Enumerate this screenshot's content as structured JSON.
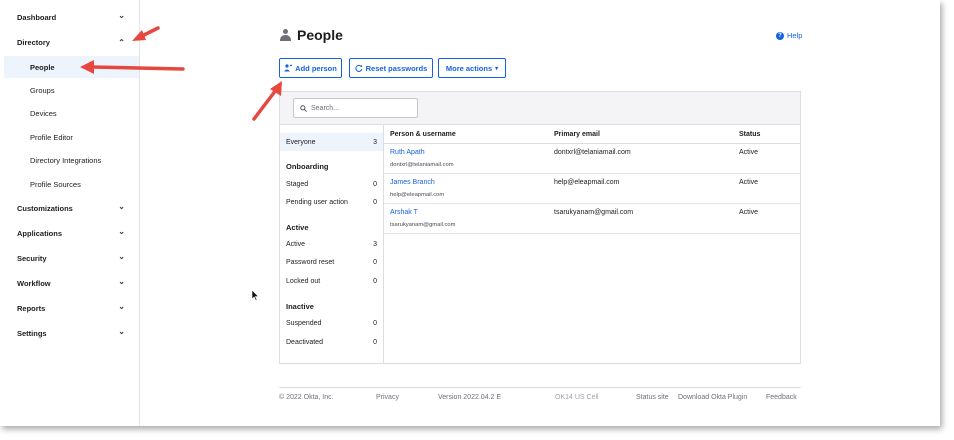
{
  "sidebar": {
    "items": [
      {
        "label": "Dashboard",
        "chevron": "⌄"
      },
      {
        "label": "Directory",
        "chevron": "⌃"
      },
      {
        "label": "People"
      },
      {
        "label": "Groups"
      },
      {
        "label": "Devices"
      },
      {
        "label": "Profile Editor"
      },
      {
        "label": "Directory Integrations"
      },
      {
        "label": "Profile Sources"
      },
      {
        "label": "Customizations",
        "chevron": "⌄"
      },
      {
        "label": "Applications",
        "chevron": "⌄"
      },
      {
        "label": "Security",
        "chevron": "⌄"
      },
      {
        "label": "Workflow",
        "chevron": "⌄"
      },
      {
        "label": "Reports",
        "chevron": "⌄"
      },
      {
        "label": "Settings",
        "chevron": "⌄"
      }
    ]
  },
  "header": {
    "title": "People",
    "help_label": "Help",
    "help_icon": "question-circle-icon"
  },
  "actions": {
    "add_person": "Add person",
    "reset_passwords": "Reset passwords",
    "more_actions": "More actions",
    "more_actions_caret": "▾"
  },
  "search": {
    "placeholder": "Search..."
  },
  "filters": {
    "everyone": {
      "label": "Everyone",
      "count": "3"
    },
    "onboarding_head": "Onboarding",
    "staged": {
      "label": "Staged",
      "count": "0"
    },
    "pending": {
      "label": "Pending user action",
      "count": "0"
    },
    "active_head": "Active",
    "active": {
      "label": "Active",
      "count": "3"
    },
    "password_reset": {
      "label": "Password reset",
      "count": "0"
    },
    "locked_out": {
      "label": "Locked out",
      "count": "0"
    },
    "inactive_head": "Inactive",
    "suspended": {
      "label": "Suspended",
      "count": "0"
    },
    "deactivated": {
      "label": "Deactivated",
      "count": "0"
    }
  },
  "table": {
    "columns": [
      "Person & username",
      "Primary email",
      "Status"
    ],
    "rows": [
      {
        "name": "Ruth Apath",
        "username": "dontxrl@telaniamail.com",
        "email": "dontxrl@telaniamail.com",
        "status": "Active"
      },
      {
        "name": "James Branch",
        "username": "help@eleapmail.com",
        "email": "help@eleapmail.com",
        "status": "Active"
      },
      {
        "name": "Arshak T",
        "username": "tsarukyanam@gmail.com",
        "email": "tsarukyanam@gmail.com",
        "status": "Active"
      }
    ]
  },
  "footer": {
    "copyright": "© 2022 Okta, Inc.",
    "privacy": "Privacy",
    "version": "Version 2022.04.2 E",
    "cell": "OK14 US Cell",
    "status_site": "Status site",
    "download_plugin": "Download Okta Plugin",
    "feedback": "Feedback"
  },
  "colors": {
    "accent": "#1662dd",
    "annotation": "#e8473f"
  }
}
